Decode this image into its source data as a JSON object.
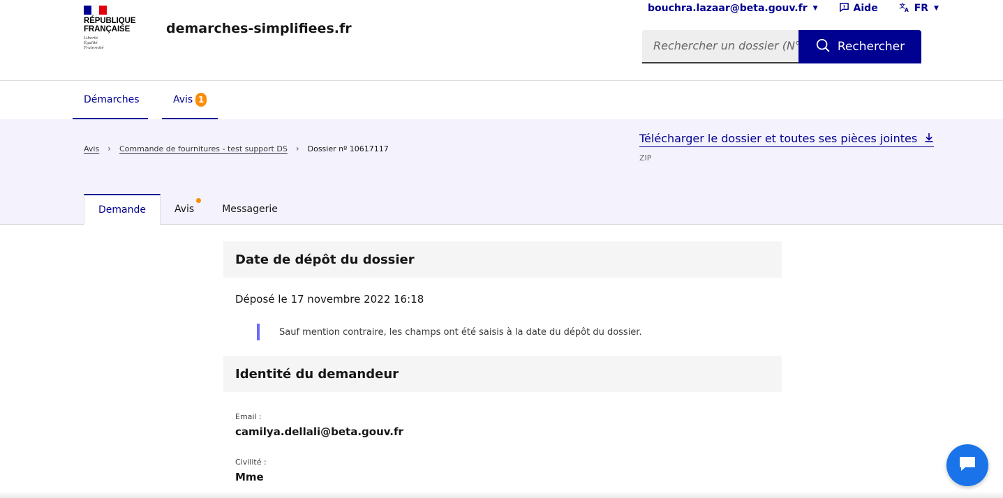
{
  "header": {
    "logo_line1": "RÉPUBLIQUE",
    "logo_line2": "FRANÇAISE",
    "motto": [
      "Liberté",
      "Égalité",
      "Fraternité"
    ],
    "site_name": "demarches-simplifiees.fr",
    "user_email": "bouchra.lazaar@beta.gouv.fr",
    "help_label": "Aide",
    "lang_label": "FR",
    "search_placeholder": "Rechercher un dossier (N°",
    "search_button": "Rechercher"
  },
  "nav": {
    "items": [
      {
        "label": "Démarches"
      },
      {
        "label": "Avis",
        "badge": "1"
      }
    ]
  },
  "breadcrumb": {
    "items": [
      "Avis",
      "Commande de fournitures - test support DS",
      "Dossier nº 10617117"
    ]
  },
  "download": {
    "label": "Télécharger le dossier et toutes ses pièces jointes",
    "format": "ZIP"
  },
  "tabs": [
    {
      "label": "Demande",
      "active": true
    },
    {
      "label": "Avis",
      "dot": true
    },
    {
      "label": "Messagerie"
    }
  ],
  "sections": {
    "deposit_title": "Date de dépôt du dossier",
    "deposit_text": "Déposé le 17 novembre 2022 16:18",
    "deposit_notice": "Sauf mention contraire, les champs ont été saisis à la date du dépôt du dossier.",
    "identity_title": "Identité du demandeur",
    "fields": [
      {
        "label": "Email :",
        "value": "camilya.dellali@beta.gouv.fr"
      },
      {
        "label": "Civilité :",
        "value": "Mme"
      }
    ]
  },
  "colors": {
    "primary": "#000091",
    "badge": "#fc8d0a",
    "subheader_bg": "#f4f2fd",
    "chat": "#1a73e8",
    "flag_blue": "#000091",
    "flag_red": "#e1000f"
  },
  "icons": {
    "search": "search-icon",
    "help": "help-icon",
    "translate": "translate-icon",
    "download": "download-icon",
    "chat": "chat-icon"
  }
}
